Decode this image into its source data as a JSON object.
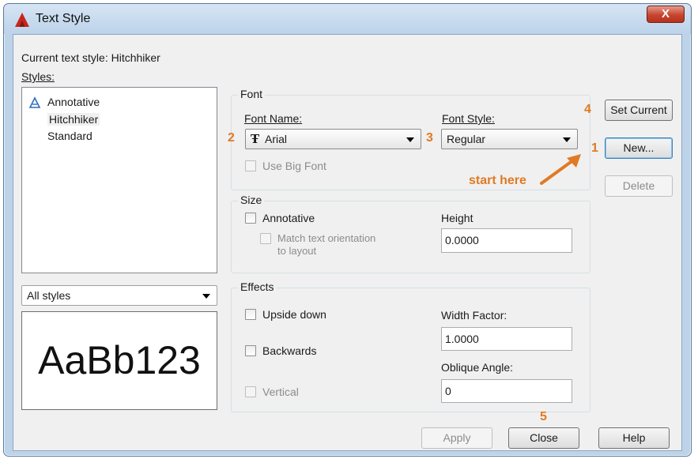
{
  "window": {
    "title": "Text Style",
    "close_glyph": "X"
  },
  "current_style": {
    "label": "Current text style:",
    "value": "Hitchhiker"
  },
  "styles": {
    "label": "Styles:",
    "items": [
      {
        "name": "Annotative",
        "icon": "annotative-icon"
      },
      {
        "name": "Hitchhiker",
        "selected": true
      },
      {
        "name": "Standard"
      }
    ],
    "filter_value": "All styles",
    "preview_text": "AaBb123"
  },
  "font": {
    "group_title": "Font",
    "font_name_label": "Font Name:",
    "font_name_value": "Arial",
    "font_style_label": "Font Style:",
    "font_style_value": "Regular",
    "use_big_font_label": "Use Big Font"
  },
  "size": {
    "group_title": "Size",
    "annotative_label": "Annotative",
    "match_label_line1": "Match text orientation",
    "match_label_line2": "to layout",
    "height_label": "Height",
    "height_value": "0.0000"
  },
  "effects": {
    "group_title": "Effects",
    "upside_down_label": "Upside down",
    "backwards_label": "Backwards",
    "vertical_label": "Vertical",
    "width_factor_label": "Width Factor:",
    "width_factor_value": "1.0000",
    "oblique_label": "Oblique Angle:",
    "oblique_value": "0"
  },
  "buttons": {
    "set_current": "Set Current",
    "new": "New...",
    "delete": "Delete",
    "apply": "Apply",
    "close": "Close",
    "help": "Help"
  },
  "annotations": {
    "step1": "1",
    "step2": "2",
    "step3": "3",
    "step4": "4",
    "step5": "5",
    "start_here": "start here"
  },
  "colors": {
    "annotation": "#e07a24",
    "title_bar": "#bcd3ea",
    "dialog_bg": "#f0f0f0"
  }
}
